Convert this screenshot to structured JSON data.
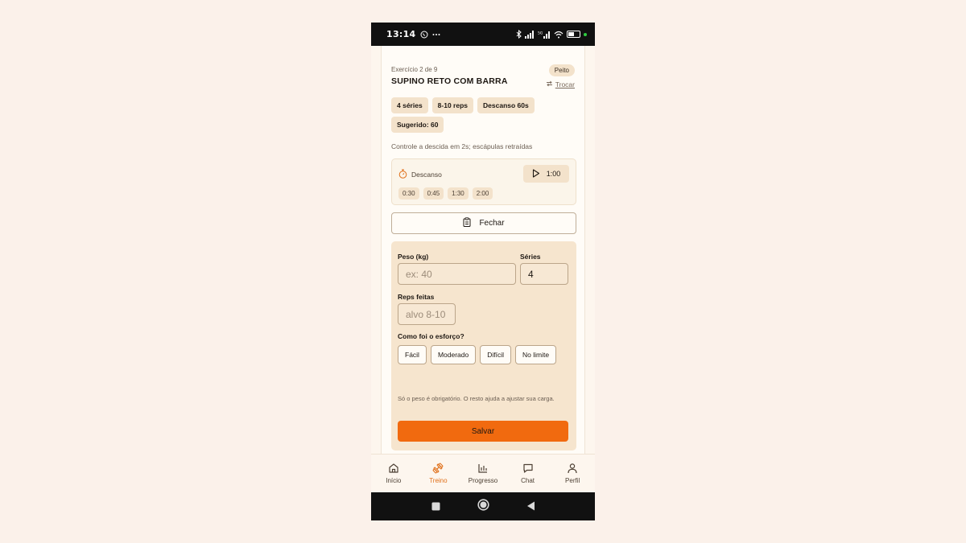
{
  "status_bar": {
    "time": "13:14",
    "network": "5G"
  },
  "exercise": {
    "counter": "Exercício 2 de 9",
    "name": "SUPINO RETO COM BARRA",
    "muscle_tag": "Peito",
    "swap_label": "Trocar",
    "chips": [
      "4 séries",
      "8-10 reps",
      "Descanso 60s",
      "Sugerido: 60"
    ],
    "hint": "Controle a descida em 2s; escápulas retraídas"
  },
  "rest_timer": {
    "label": "Descanso",
    "time": "1:00",
    "presets": [
      "0:30",
      "0:45",
      "1:30",
      "2:00"
    ]
  },
  "close_button": "Fechar",
  "log_form": {
    "weight_label": "Peso (kg)",
    "weight_placeholder": "ex: 40",
    "sets_label": "Séries",
    "sets_value": "4",
    "reps_label": "Reps feitas",
    "reps_placeholder": "alvo 8-10",
    "effort_label": "Como foi o esforço?",
    "effort_options": [
      "Fácil",
      "Moderado",
      "Difícil",
      "No limite"
    ],
    "note": "Só o peso é obrigatório. O resto ajuda a ajustar sua carga.",
    "save_label": "Salvar"
  },
  "bottom_nav": [
    {
      "label": "Início",
      "icon": "home-icon",
      "active": false
    },
    {
      "label": "Treino",
      "icon": "dumbbell-icon",
      "active": true
    },
    {
      "label": "Progresso",
      "icon": "bar-chart-icon",
      "active": false
    },
    {
      "label": "Chat",
      "icon": "chat-icon",
      "active": false
    },
    {
      "label": "Perfil",
      "icon": "user-icon",
      "active": false
    }
  ],
  "colors": {
    "accent": "#f16a0f",
    "active_nav": "#e0701a",
    "chip_bg": "#f3e2cb",
    "form_bg": "#f6e5ce"
  }
}
